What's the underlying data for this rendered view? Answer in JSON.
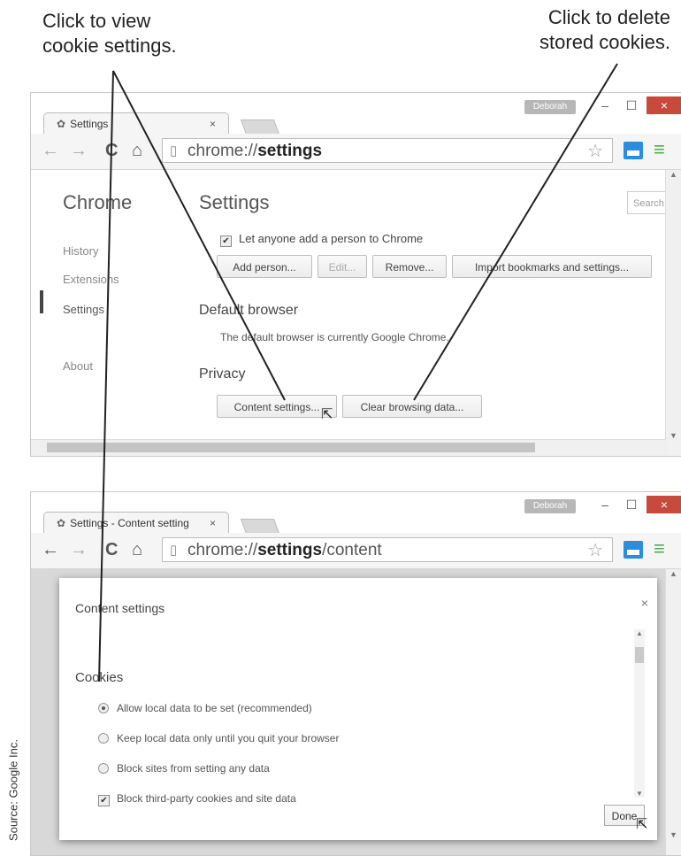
{
  "callouts": {
    "left": [
      "Click to view",
      "cookie settings."
    ],
    "right": [
      "Click to delete",
      "stored cookies."
    ]
  },
  "source": "Source: Google Inc.",
  "window1": {
    "tab_label": "Settings",
    "tab_close": "×",
    "user": "Deborah",
    "win_controls": {
      "min": "–",
      "max": "☐",
      "close": "×"
    },
    "url_prefix": "chrome://",
    "url_bold": "settings",
    "sidebar": {
      "title": "Chrome",
      "items": [
        "History",
        "Extensions",
        "Settings",
        "About"
      ],
      "selected": "Settings"
    },
    "main": {
      "title": "Settings",
      "search_placeholder": "Search",
      "checkbox_label": "Let anyone add a person to Chrome",
      "buttons": [
        "Add person...",
        "Edit...",
        "Remove...",
        "Import bookmarks and settings..."
      ],
      "default_browser_heading": "Default browser",
      "default_browser_text": "The default browser is currently Google Chrome.",
      "privacy_heading": "Privacy",
      "content_settings_btn": "Content settings...",
      "clear_data_btn": "Clear browsing data..."
    }
  },
  "window2": {
    "tab_label": "Settings - Content setting",
    "tab_close": "×",
    "user": "Deborah",
    "win_controls": {
      "min": "–",
      "max": "☐",
      "close": "×"
    },
    "url_prefix": "chrome://",
    "url_bold": "settings",
    "url_suffix": "/content",
    "dialog": {
      "title": "Content settings",
      "close": "×",
      "section": "Cookies",
      "options": [
        "Allow local data to be set (recommended)",
        "Keep local data only until you quit your browser",
        "Block sites from setting any data"
      ],
      "selected_option": 0,
      "checkbox_label": "Block third-party cookies and site data",
      "checkbox_checked": true,
      "done": "Done"
    }
  },
  "colors": {
    "close_button": "#c74a3c",
    "extension_icon": "#2a8de0",
    "menu_icon": "#4caf50"
  }
}
